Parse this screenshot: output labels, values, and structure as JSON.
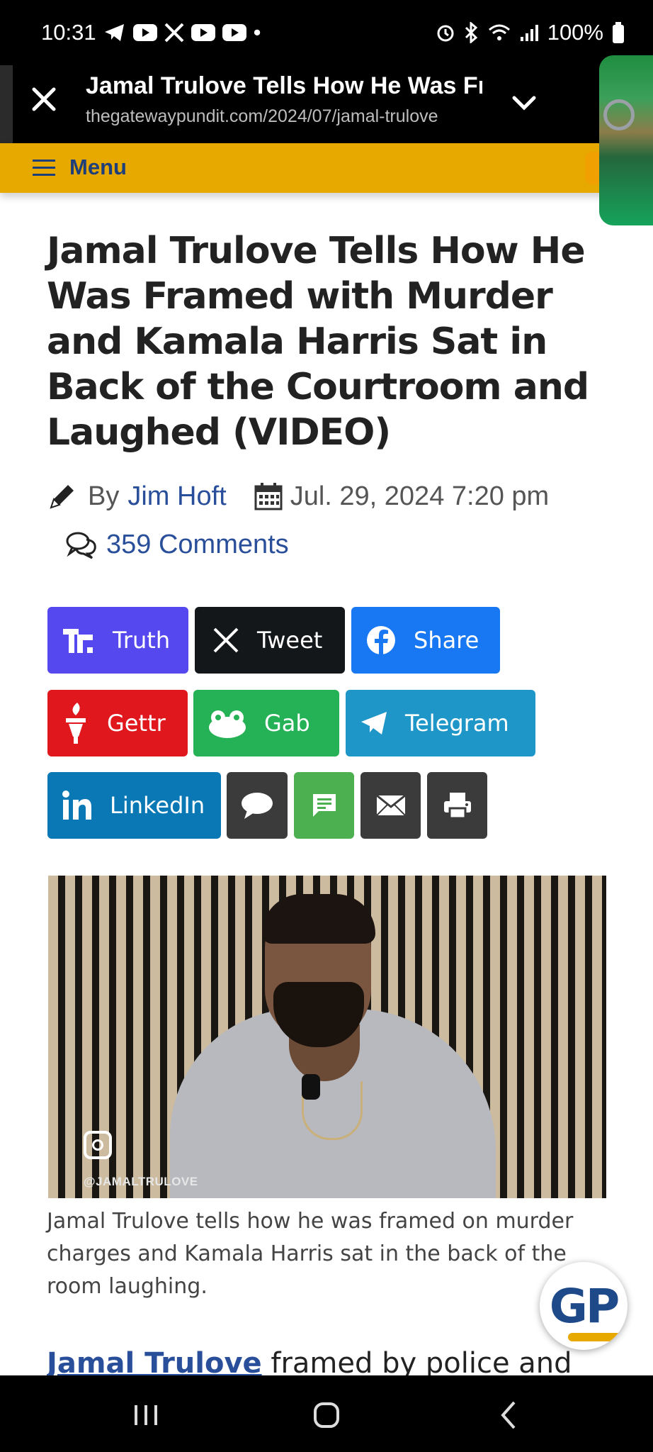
{
  "status_bar": {
    "time": "10:31",
    "battery": "100%",
    "dot": "•"
  },
  "tab": {
    "title": "Jamal Trulove Tells How He Was Framed",
    "url": "thegatewaypundit.com/2024/07/jamal-trulove"
  },
  "menu": {
    "label": "Menu"
  },
  "article": {
    "title": "Jamal Trulove Tells How He Was Framed with Murder and Kamala Harris Sat in Back of the Courtroom and Laughed (VIDEO)",
    "by": "By",
    "author": "Jim Hoft",
    "date": "Jul. 29, 2024 7:20 pm",
    "comments": "359 Comments"
  },
  "share_buttons": [
    {
      "label": "Truth",
      "color": "#5448ee"
    },
    {
      "label": "Tweet",
      "color": "#14171a"
    },
    {
      "label": "Share",
      "color": "#1877f2"
    },
    {
      "label": "Gettr",
      "color": "#e0171d"
    },
    {
      "label": "Gab",
      "color": "#25b155"
    },
    {
      "label": "Telegram",
      "color": "#1e96c8"
    },
    {
      "label": "LinkedIn",
      "color": "#0a78b5"
    }
  ],
  "video": {
    "watermark": "@JAMALTRULOVE"
  },
  "caption": "Jamal Trulove tells how he was framed on murder charges and Kamala Harris sat in the back of the room laughing.",
  "body": {
    "link": "Jamal Trulove",
    "text": " framed by police and"
  },
  "gp_logo": "GP"
}
